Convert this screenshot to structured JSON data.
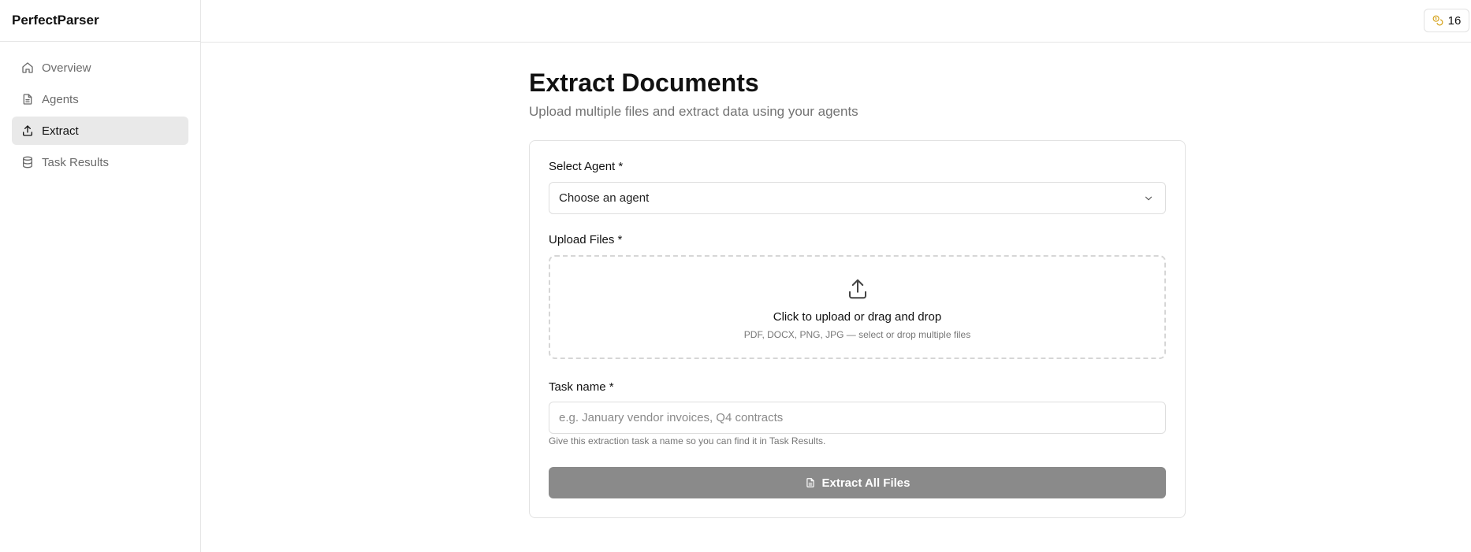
{
  "app": {
    "brand": "PerfectParser"
  },
  "sidebar": {
    "items": [
      {
        "label": "Overview",
        "icon": "home-icon",
        "active": false
      },
      {
        "label": "Agents",
        "icon": "document-icon",
        "active": false
      },
      {
        "label": "Extract",
        "icon": "upload-icon",
        "active": true
      },
      {
        "label": "Task Results",
        "icon": "database-icon",
        "active": false
      }
    ]
  },
  "topbar": {
    "credits": {
      "icon": "coins-icon",
      "value": "16",
      "icon_color": "#d4a017"
    }
  },
  "main": {
    "title": "Extract Documents",
    "subtitle": "Upload multiple files and extract data using your agents",
    "form": {
      "agent_label": "Select Agent *",
      "agent_value": "Choose an agent",
      "upload_label": "Upload Files *",
      "upload_title": "Click to upload or drag and drop",
      "upload_hint": "PDF, DOCX, PNG, JPG — select or drop multiple files",
      "task_label": "Task name *",
      "task_placeholder": "e.g. January vendor invoices, Q4 contracts",
      "task_value": "",
      "task_help": "Give this extraction task a name so you can find it in Task Results.",
      "submit_label": "Extract All Files",
      "submit_color": "#8a8a8a"
    }
  }
}
